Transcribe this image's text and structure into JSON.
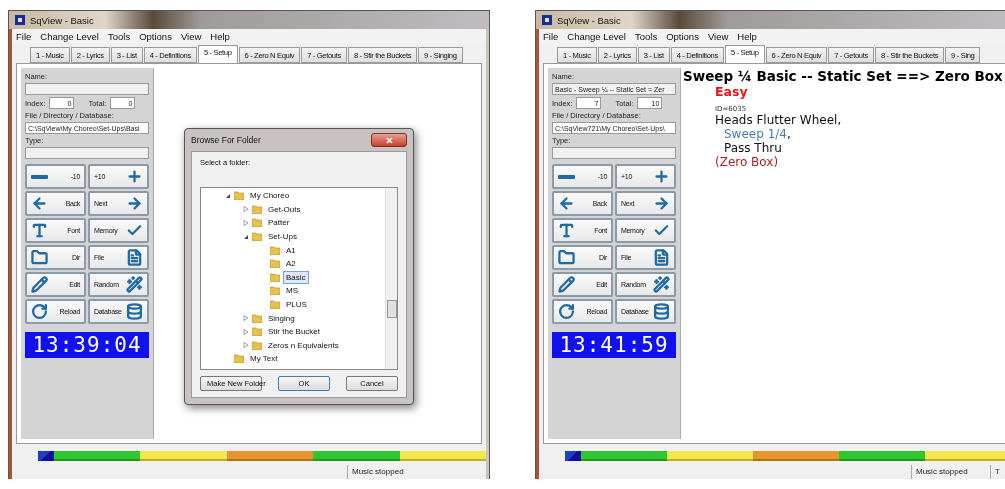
{
  "windows": [
    {
      "title": "SqView - Basic",
      "menu": [
        "File",
        "Change Level",
        "Tools",
        "Options",
        "View",
        "Help"
      ],
      "tabs": [
        {
          "label": "1 - Music",
          "selected": false
        },
        {
          "label": "2 - Lyrics",
          "selected": false
        },
        {
          "label": "3 - List",
          "selected": false
        },
        {
          "label": "4 - Definitions",
          "selected": false
        },
        {
          "label": "5 - Setup",
          "selected": true
        },
        {
          "label": "6 - Zero N Equiv",
          "selected": false
        },
        {
          "label": "7 - Getouts",
          "selected": false
        },
        {
          "label": "8 - Stir the Buckets",
          "selected": false
        },
        {
          "label": "9 - Singing",
          "selected": false
        }
      ],
      "name_label": "Name:",
      "index_label": "Index:",
      "index": "0",
      "total_label": "Total:",
      "total": "0",
      "file_label": "File / Directory / Database:",
      "file": "C:\\SqView\\My Choreo\\Set-Ups\\Basi",
      "type_label": "Type:",
      "buttons": [
        "-10",
        "+10",
        "Back",
        "Next",
        "Font",
        "Memory",
        "Dir",
        "File",
        "Edit",
        "Random",
        "Reload",
        "Database"
      ],
      "clock": "13:39:04",
      "dialog": {
        "title": "Browse For Folder",
        "prompt": "Select a folder:",
        "tree": [
          {
            "label": "My Choreo",
            "expanded": true,
            "selected": false,
            "children": [
              {
                "label": "Get-Outs",
                "expanded": false,
                "selected": false
              },
              {
                "label": "Patter",
                "expanded": false,
                "selected": false
              },
              {
                "label": "Set-Ups",
                "expanded": true,
                "selected": false,
                "children": [
                  {
                    "label": "A1",
                    "selected": false
                  },
                  {
                    "label": "A2",
                    "selected": false
                  },
                  {
                    "label": "Basic",
                    "selected": true
                  },
                  {
                    "label": "MS",
                    "selected": false
                  },
                  {
                    "label": "PLUS",
                    "selected": false
                  }
                ]
              },
              {
                "label": "Singing",
                "expanded": false,
                "selected": false
              },
              {
                "label": "Stir the Bucket",
                "expanded": false,
                "selected": false
              },
              {
                "label": "Zeros n Equivalents",
                "expanded": false,
                "selected": false
              }
            ]
          },
          {
            "label": "My Text",
            "selected": false
          }
        ],
        "buttons": [
          "Make New Folder",
          "OK",
          "Cancel"
        ]
      },
      "timeline": [
        {
          "color": "#2ec82e"
        },
        {
          "color": "#f2e84a"
        },
        {
          "color": "#e8952c"
        },
        {
          "color": "#2ec82e"
        },
        {
          "color": "#f2e84a"
        }
      ],
      "status": [
        "Music stopped"
      ]
    },
    {
      "title": "SqView - Basic",
      "menu": [
        "File",
        "Change Level",
        "Tools",
        "Options",
        "View",
        "Help"
      ],
      "tabs": [
        {
          "label": "1 - Music",
          "selected": false
        },
        {
          "label": "2 - Lyrics",
          "selected": false
        },
        {
          "label": "3 - List",
          "selected": false
        },
        {
          "label": "4 - Definitions",
          "selected": false
        },
        {
          "label": "5 - Setup",
          "selected": true
        },
        {
          "label": "6 - Zero N Equiv",
          "selected": false
        },
        {
          "label": "7 - Getouts",
          "selected": false
        },
        {
          "label": "8 - Stir the Buckets",
          "selected": false
        },
        {
          "label": "9 - Sing",
          "selected": false
        }
      ],
      "name_label": "Name:",
      "name": "Basic - Sweep ¼ -- Static Set = Zer",
      "index_label": "Index:",
      "index": "7",
      "total_label": "Total:",
      "total": "10",
      "file_label": "File / Directory / Database:",
      "file": "C:\\SqView721\\My Choreo\\Set-Ups\\",
      "type_label": "Type:",
      "buttons": [
        "-10",
        "+10",
        "Back",
        "Next",
        "Font",
        "Memory",
        "Dir",
        "File",
        "Edit",
        "Random",
        "Reload",
        "Database"
      ],
      "clock": "13:41:59",
      "content": [
        {
          "kind": "heading",
          "parts": [
            {
              "text": "Sweep ¼ Basic -- Static Set ==> Zero Box",
              "kind": "plain"
            }
          ]
        },
        {
          "kind": "level",
          "parts": [
            {
              "text": "Easy",
              "kind": "plain"
            }
          ]
        },
        {
          "kind": "id",
          "parts": [
            {
              "text": "ID=6035",
              "kind": "plain"
            }
          ]
        },
        {
          "kind": "call",
          "parts": [
            {
              "text": "Heads Flutter Wheel,",
              "kind": "plain"
            }
          ]
        },
        {
          "kind": "subcall",
          "parts": [
            {
              "text": "Sweep 1/4",
              "kind": "link"
            },
            {
              "text": ",",
              "kind": "plain"
            }
          ]
        },
        {
          "kind": "subcall",
          "parts": [
            {
              "text": "Pass Thru",
              "kind": "plain"
            }
          ]
        },
        {
          "kind": "result",
          "parts": [
            {
              "text": "(Zero Box)",
              "kind": "plain"
            }
          ]
        }
      ],
      "timeline": [
        {
          "color": "#2ec82e"
        },
        {
          "color": "#f2e84a"
        },
        {
          "color": "#e8952c"
        },
        {
          "color": "#2ec82e"
        },
        {
          "color": "#f2e84a"
        }
      ],
      "status": [
        "Music stopped",
        "T"
      ]
    }
  ]
}
